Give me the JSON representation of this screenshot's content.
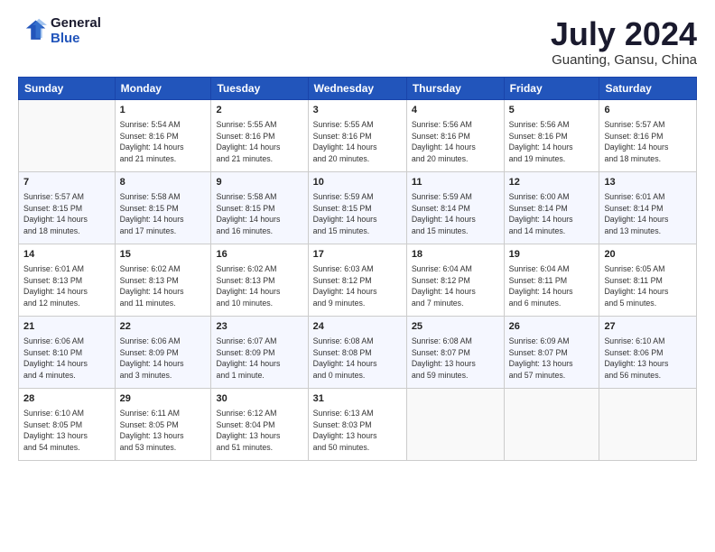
{
  "header": {
    "logo_line1": "General",
    "logo_line2": "Blue",
    "month_year": "July 2024",
    "location": "Guanting, Gansu, China"
  },
  "days_of_week": [
    "Sunday",
    "Monday",
    "Tuesday",
    "Wednesday",
    "Thursday",
    "Friday",
    "Saturday"
  ],
  "weeks": [
    [
      {
        "day": "",
        "info": ""
      },
      {
        "day": "1",
        "info": "Sunrise: 5:54 AM\nSunset: 8:16 PM\nDaylight: 14 hours\nand 21 minutes."
      },
      {
        "day": "2",
        "info": "Sunrise: 5:55 AM\nSunset: 8:16 PM\nDaylight: 14 hours\nand 21 minutes."
      },
      {
        "day": "3",
        "info": "Sunrise: 5:55 AM\nSunset: 8:16 PM\nDaylight: 14 hours\nand 20 minutes."
      },
      {
        "day": "4",
        "info": "Sunrise: 5:56 AM\nSunset: 8:16 PM\nDaylight: 14 hours\nand 20 minutes."
      },
      {
        "day": "5",
        "info": "Sunrise: 5:56 AM\nSunset: 8:16 PM\nDaylight: 14 hours\nand 19 minutes."
      },
      {
        "day": "6",
        "info": "Sunrise: 5:57 AM\nSunset: 8:16 PM\nDaylight: 14 hours\nand 18 minutes."
      }
    ],
    [
      {
        "day": "7",
        "info": "Sunrise: 5:57 AM\nSunset: 8:15 PM\nDaylight: 14 hours\nand 18 minutes."
      },
      {
        "day": "8",
        "info": "Sunrise: 5:58 AM\nSunset: 8:15 PM\nDaylight: 14 hours\nand 17 minutes."
      },
      {
        "day": "9",
        "info": "Sunrise: 5:58 AM\nSunset: 8:15 PM\nDaylight: 14 hours\nand 16 minutes."
      },
      {
        "day": "10",
        "info": "Sunrise: 5:59 AM\nSunset: 8:15 PM\nDaylight: 14 hours\nand 15 minutes."
      },
      {
        "day": "11",
        "info": "Sunrise: 5:59 AM\nSunset: 8:14 PM\nDaylight: 14 hours\nand 15 minutes."
      },
      {
        "day": "12",
        "info": "Sunrise: 6:00 AM\nSunset: 8:14 PM\nDaylight: 14 hours\nand 14 minutes."
      },
      {
        "day": "13",
        "info": "Sunrise: 6:01 AM\nSunset: 8:14 PM\nDaylight: 14 hours\nand 13 minutes."
      }
    ],
    [
      {
        "day": "14",
        "info": "Sunrise: 6:01 AM\nSunset: 8:13 PM\nDaylight: 14 hours\nand 12 minutes."
      },
      {
        "day": "15",
        "info": "Sunrise: 6:02 AM\nSunset: 8:13 PM\nDaylight: 14 hours\nand 11 minutes."
      },
      {
        "day": "16",
        "info": "Sunrise: 6:02 AM\nSunset: 8:13 PM\nDaylight: 14 hours\nand 10 minutes."
      },
      {
        "day": "17",
        "info": "Sunrise: 6:03 AM\nSunset: 8:12 PM\nDaylight: 14 hours\nand 9 minutes."
      },
      {
        "day": "18",
        "info": "Sunrise: 6:04 AM\nSunset: 8:12 PM\nDaylight: 14 hours\nand 7 minutes."
      },
      {
        "day": "19",
        "info": "Sunrise: 6:04 AM\nSunset: 8:11 PM\nDaylight: 14 hours\nand 6 minutes."
      },
      {
        "day": "20",
        "info": "Sunrise: 6:05 AM\nSunset: 8:11 PM\nDaylight: 14 hours\nand 5 minutes."
      }
    ],
    [
      {
        "day": "21",
        "info": "Sunrise: 6:06 AM\nSunset: 8:10 PM\nDaylight: 14 hours\nand 4 minutes."
      },
      {
        "day": "22",
        "info": "Sunrise: 6:06 AM\nSunset: 8:09 PM\nDaylight: 14 hours\nand 3 minutes."
      },
      {
        "day": "23",
        "info": "Sunrise: 6:07 AM\nSunset: 8:09 PM\nDaylight: 14 hours\nand 1 minute."
      },
      {
        "day": "24",
        "info": "Sunrise: 6:08 AM\nSunset: 8:08 PM\nDaylight: 14 hours\nand 0 minutes."
      },
      {
        "day": "25",
        "info": "Sunrise: 6:08 AM\nSunset: 8:07 PM\nDaylight: 13 hours\nand 59 minutes."
      },
      {
        "day": "26",
        "info": "Sunrise: 6:09 AM\nSunset: 8:07 PM\nDaylight: 13 hours\nand 57 minutes."
      },
      {
        "day": "27",
        "info": "Sunrise: 6:10 AM\nSunset: 8:06 PM\nDaylight: 13 hours\nand 56 minutes."
      }
    ],
    [
      {
        "day": "28",
        "info": "Sunrise: 6:10 AM\nSunset: 8:05 PM\nDaylight: 13 hours\nand 54 minutes."
      },
      {
        "day": "29",
        "info": "Sunrise: 6:11 AM\nSunset: 8:05 PM\nDaylight: 13 hours\nand 53 minutes."
      },
      {
        "day": "30",
        "info": "Sunrise: 6:12 AM\nSunset: 8:04 PM\nDaylight: 13 hours\nand 51 minutes."
      },
      {
        "day": "31",
        "info": "Sunrise: 6:13 AM\nSunset: 8:03 PM\nDaylight: 13 hours\nand 50 minutes."
      },
      {
        "day": "",
        "info": ""
      },
      {
        "day": "",
        "info": ""
      },
      {
        "day": "",
        "info": ""
      }
    ]
  ]
}
